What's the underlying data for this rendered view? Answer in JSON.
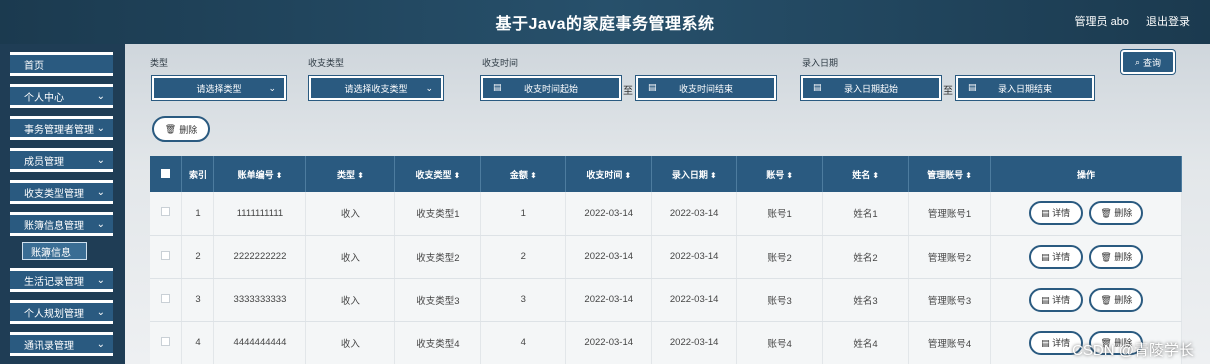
{
  "app": {
    "title": "基于Java的家庭事务管理系统",
    "user": "管理员 abo",
    "logout": "退出登录"
  },
  "sidebar": {
    "items": [
      {
        "label": "首页",
        "chevron": ""
      },
      {
        "label": "个人中心",
        "chevron": "⌄"
      },
      {
        "label": "事务管理者管理",
        "chevron": "⌄"
      },
      {
        "label": "成员管理",
        "chevron": "⌄"
      },
      {
        "label": "收支类型管理",
        "chevron": "⌄"
      },
      {
        "label": "账簿信息管理",
        "chevron": "⌄"
      },
      {
        "label": "生活记录管理",
        "chevron": "⌄"
      },
      {
        "label": "个人规划管理",
        "chevron": "⌄"
      },
      {
        "label": "通讯录管理",
        "chevron": "⌄"
      }
    ],
    "sub_item": "账簿信息"
  },
  "filters": {
    "type_label": "类型",
    "type_placeholder": "请选择类型",
    "inout_label": "收支类型",
    "inout_placeholder": "请选择收支类型",
    "time_label": "收支时间",
    "time_start": "收支时间起始",
    "time_end": "收支时间结束",
    "entry_label": "录入日期",
    "entry_start": "录入日期起始",
    "entry_end": "录入日期结束",
    "to": "至",
    "search": "查询",
    "delete": "删除"
  },
  "table": {
    "headers": [
      "索引",
      "账单编号",
      "类型",
      "收支类型",
      "金额",
      "收支时间",
      "录入日期",
      "账号",
      "姓名",
      "管理账号",
      "操作"
    ],
    "detail_label": "详情",
    "delete_label": "删除",
    "rows": [
      {
        "idx": "1",
        "no": "1111111111",
        "type": "收入",
        "inout": "收支类型1",
        "amount": "1",
        "time": "2022-03-14",
        "entry": "2022-03-14",
        "account": "账号1",
        "name": "姓名1",
        "manager": "管理账号1"
      },
      {
        "idx": "2",
        "no": "2222222222",
        "type": "收入",
        "inout": "收支类型2",
        "amount": "2",
        "time": "2022-03-14",
        "entry": "2022-03-14",
        "account": "账号2",
        "name": "姓名2",
        "manager": "管理账号2"
      },
      {
        "idx": "3",
        "no": "3333333333",
        "type": "收入",
        "inout": "收支类型3",
        "amount": "3",
        "time": "2022-03-14",
        "entry": "2022-03-14",
        "account": "账号3",
        "name": "姓名3",
        "manager": "管理账号3"
      },
      {
        "idx": "4",
        "no": "4444444444",
        "type": "收入",
        "inout": "收支类型4",
        "amount": "4",
        "time": "2022-03-14",
        "entry": "2022-03-14",
        "account": "账号4",
        "name": "姓名4",
        "manager": "管理账号4"
      }
    ]
  },
  "watermark": "CSDN @青陵学长"
}
